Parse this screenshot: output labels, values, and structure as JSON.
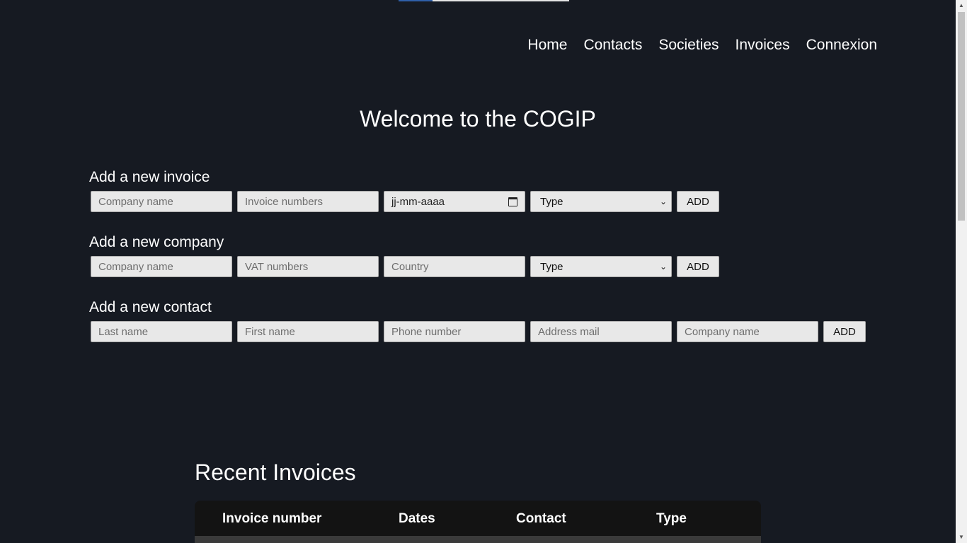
{
  "progress": {
    "value_percent": 20,
    "fill_color": "#2f5fa8",
    "track_color": "#e5e5e5"
  },
  "nav": {
    "items": [
      {
        "label": "Home"
      },
      {
        "label": "Contacts"
      },
      {
        "label": "Societies"
      },
      {
        "label": "Invoices"
      },
      {
        "label": "Connexion"
      }
    ]
  },
  "welcome": {
    "title": "Welcome to the COGIP"
  },
  "invoice_form": {
    "heading": "Add a new invoice",
    "company_placeholder": "Company name",
    "number_placeholder": "Invoice numbers",
    "date_placeholder": "jj-mm-aaaa",
    "type_selected": "Type",
    "add_label": "ADD"
  },
  "company_form": {
    "heading": "Add a new company",
    "company_placeholder": "Company name",
    "vat_placeholder": "VAT numbers",
    "country_placeholder": "Country",
    "type_selected": "Type",
    "add_label": "ADD"
  },
  "contact_form": {
    "heading": "Add a new contact",
    "lastname_placeholder": "Last name",
    "firstname_placeholder": "First name",
    "phone_placeholder": "Phone number",
    "mail_placeholder": "Address mail",
    "company_placeholder": "Company name",
    "add_label": "ADD"
  },
  "recent_invoices": {
    "title": "Recent Invoices",
    "columns": [
      "Invoice number",
      "Dates",
      "Contact",
      "Type"
    ]
  },
  "colors": {
    "background": "#161a22",
    "table_header": "#131313",
    "input_bg": "#e8e8e8"
  }
}
